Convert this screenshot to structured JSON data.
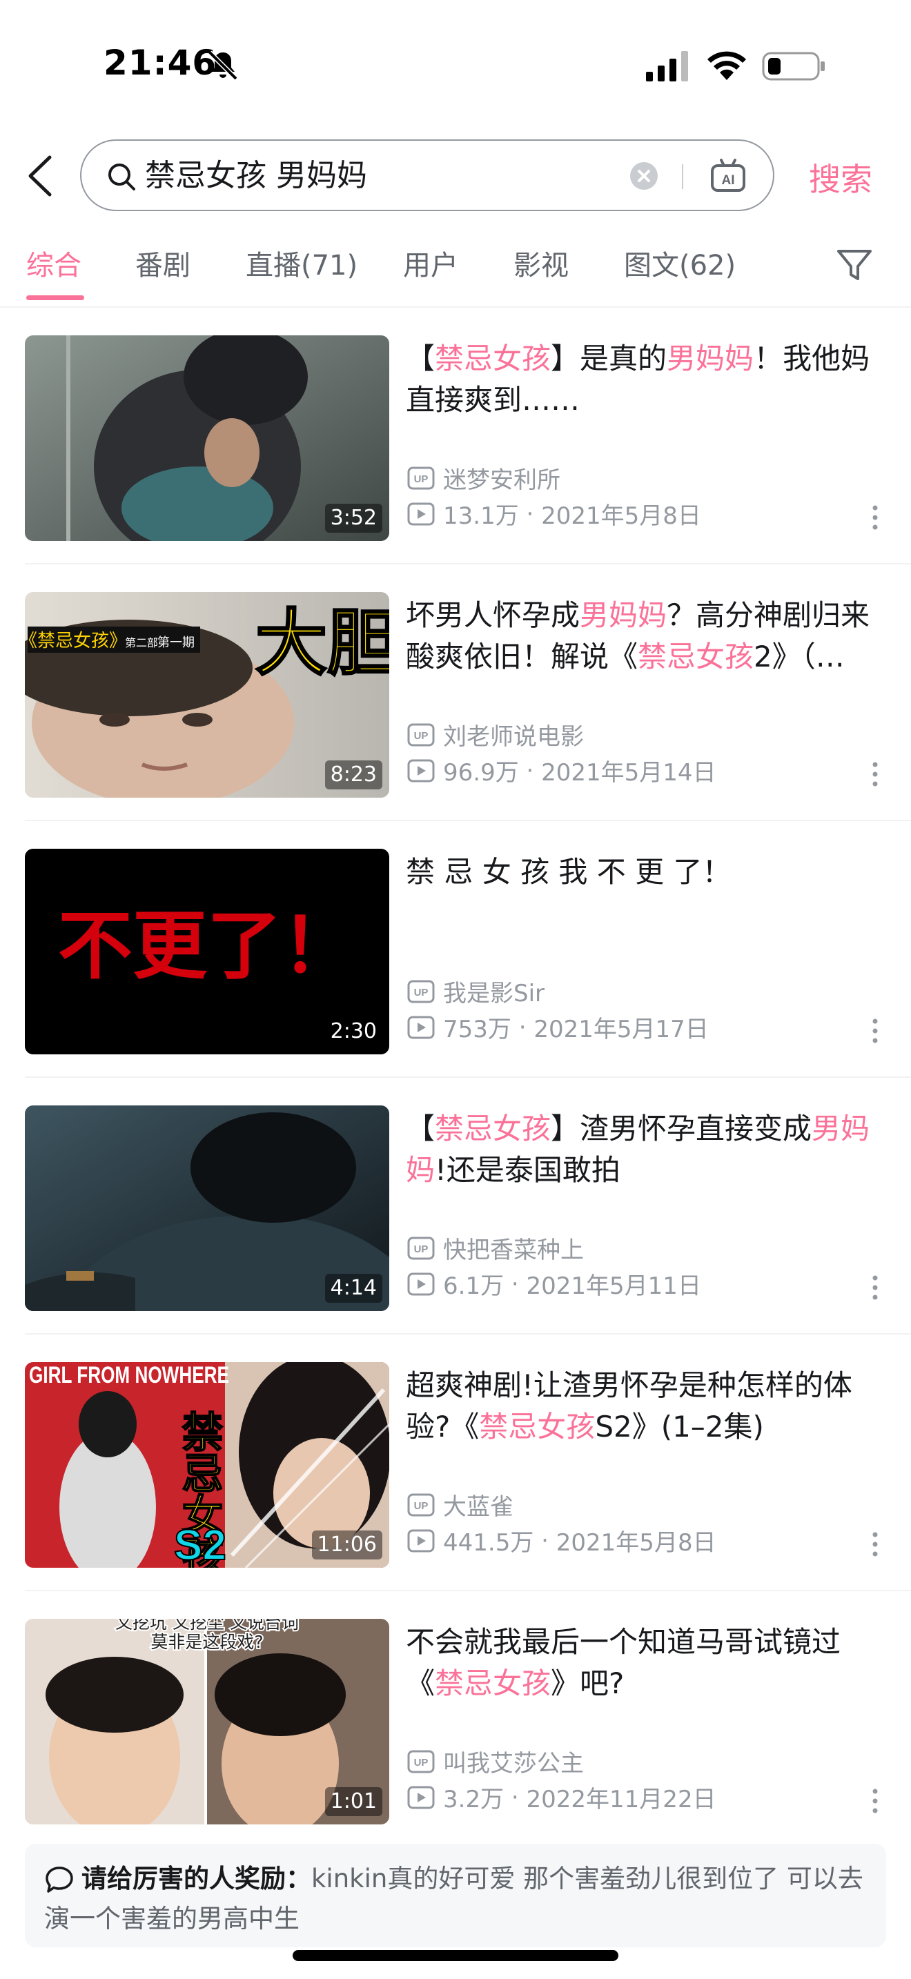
{
  "status_bar": {
    "time": "21:46",
    "icons": [
      "bell-slash-icon",
      "signal-icon",
      "wifi-icon",
      "battery-icon"
    ]
  },
  "search": {
    "query": "禁忌女孩 男妈妈",
    "button_label": "搜索",
    "icons": [
      "back-icon",
      "search-icon",
      "clear-icon",
      "ai-icon"
    ]
  },
  "tabs": [
    "综合",
    "番剧",
    "直播(71)",
    "用户",
    "影视",
    "图文(62)"
  ],
  "active_tab": "综合",
  "colors": {
    "accent": "#fb7299",
    "text": "#18191c",
    "secondary": "#9499a0"
  },
  "results": [
    {
      "title_parts": [
        [
          "【",
          false
        ],
        [
          "禁忌女孩",
          true
        ],
        [
          "】是真的",
          false
        ],
        [
          "男妈妈",
          true
        ],
        [
          "！我他妈直接爽到……",
          false
        ]
      ],
      "duration": "3:52",
      "author": "迷梦安利所",
      "views": "13.1万",
      "date": "2021年5月8日"
    },
    {
      "title_parts": [
        [
          "坏男人怀孕成",
          false
        ],
        [
          "男妈妈",
          true
        ],
        [
          "？高分神剧归来酸爽依旧！解说《",
          false
        ],
        [
          "禁忌女孩",
          true
        ],
        [
          "2》（…",
          false
        ]
      ],
      "duration": "8:23",
      "author": "刘老师说电影",
      "views": "96.9万",
      "date": "2021年5月14日",
      "thumb_text": {
        "series": "《禁忌女孩》",
        "part": "第二部",
        "episode": "第一期",
        "big": "大胆"
      }
    },
    {
      "title_parts": [
        [
          "禁 忌 女 孩 我 不 更 了！",
          false
        ]
      ],
      "duration": "2:30",
      "author": "我是影Sir",
      "views": "753万",
      "date": "2021年5月17日",
      "thumb_text": {
        "big": "不更了！"
      }
    },
    {
      "title_parts": [
        [
          "【",
          false
        ],
        [
          "禁忌女孩",
          true
        ],
        [
          "】渣男怀孕直接变成",
          false
        ],
        [
          "男妈妈",
          true
        ],
        [
          "!还是泰国敢拍",
          false
        ]
      ],
      "duration": "4:14",
      "author": "快把香菜种上",
      "views": "6.1万",
      "date": "2021年5月11日"
    },
    {
      "title_parts": [
        [
          "超爽神剧!让渣男怀孕是种怎样的体验?《",
          false
        ],
        [
          "禁忌女孩",
          true
        ],
        [
          "S2》(1–2集)",
          false
        ]
      ],
      "duration": "11:06",
      "author": "大蓝雀",
      "views": "441.5万",
      "date": "2021年5月8日",
      "thumb_text": {
        "corner": "GIRL FROM NOWHERE",
        "big": "禁忌女孩",
        "season": "S2"
      }
    },
    {
      "title_parts": [
        [
          "不会就我最后一个知道马哥试镜过《",
          false
        ],
        [
          "禁忌女孩",
          true
        ],
        [
          "》吧?",
          false
        ]
      ],
      "duration": "1:01",
      "author": "叫我艾莎公主",
      "views": "3.2万",
      "date": "2022年11月22日",
      "thumb_text": {
        "caption1": "又挖坑 又挖尘 又说台词",
        "caption2": "莫非是这段戏?"
      }
    }
  ],
  "comment": {
    "prefix": "请给厉害的人奖励：",
    "text": "kinkin真的好可爱  那个害羞劲儿很到位了 可以去演一个害羞的男高中生"
  }
}
